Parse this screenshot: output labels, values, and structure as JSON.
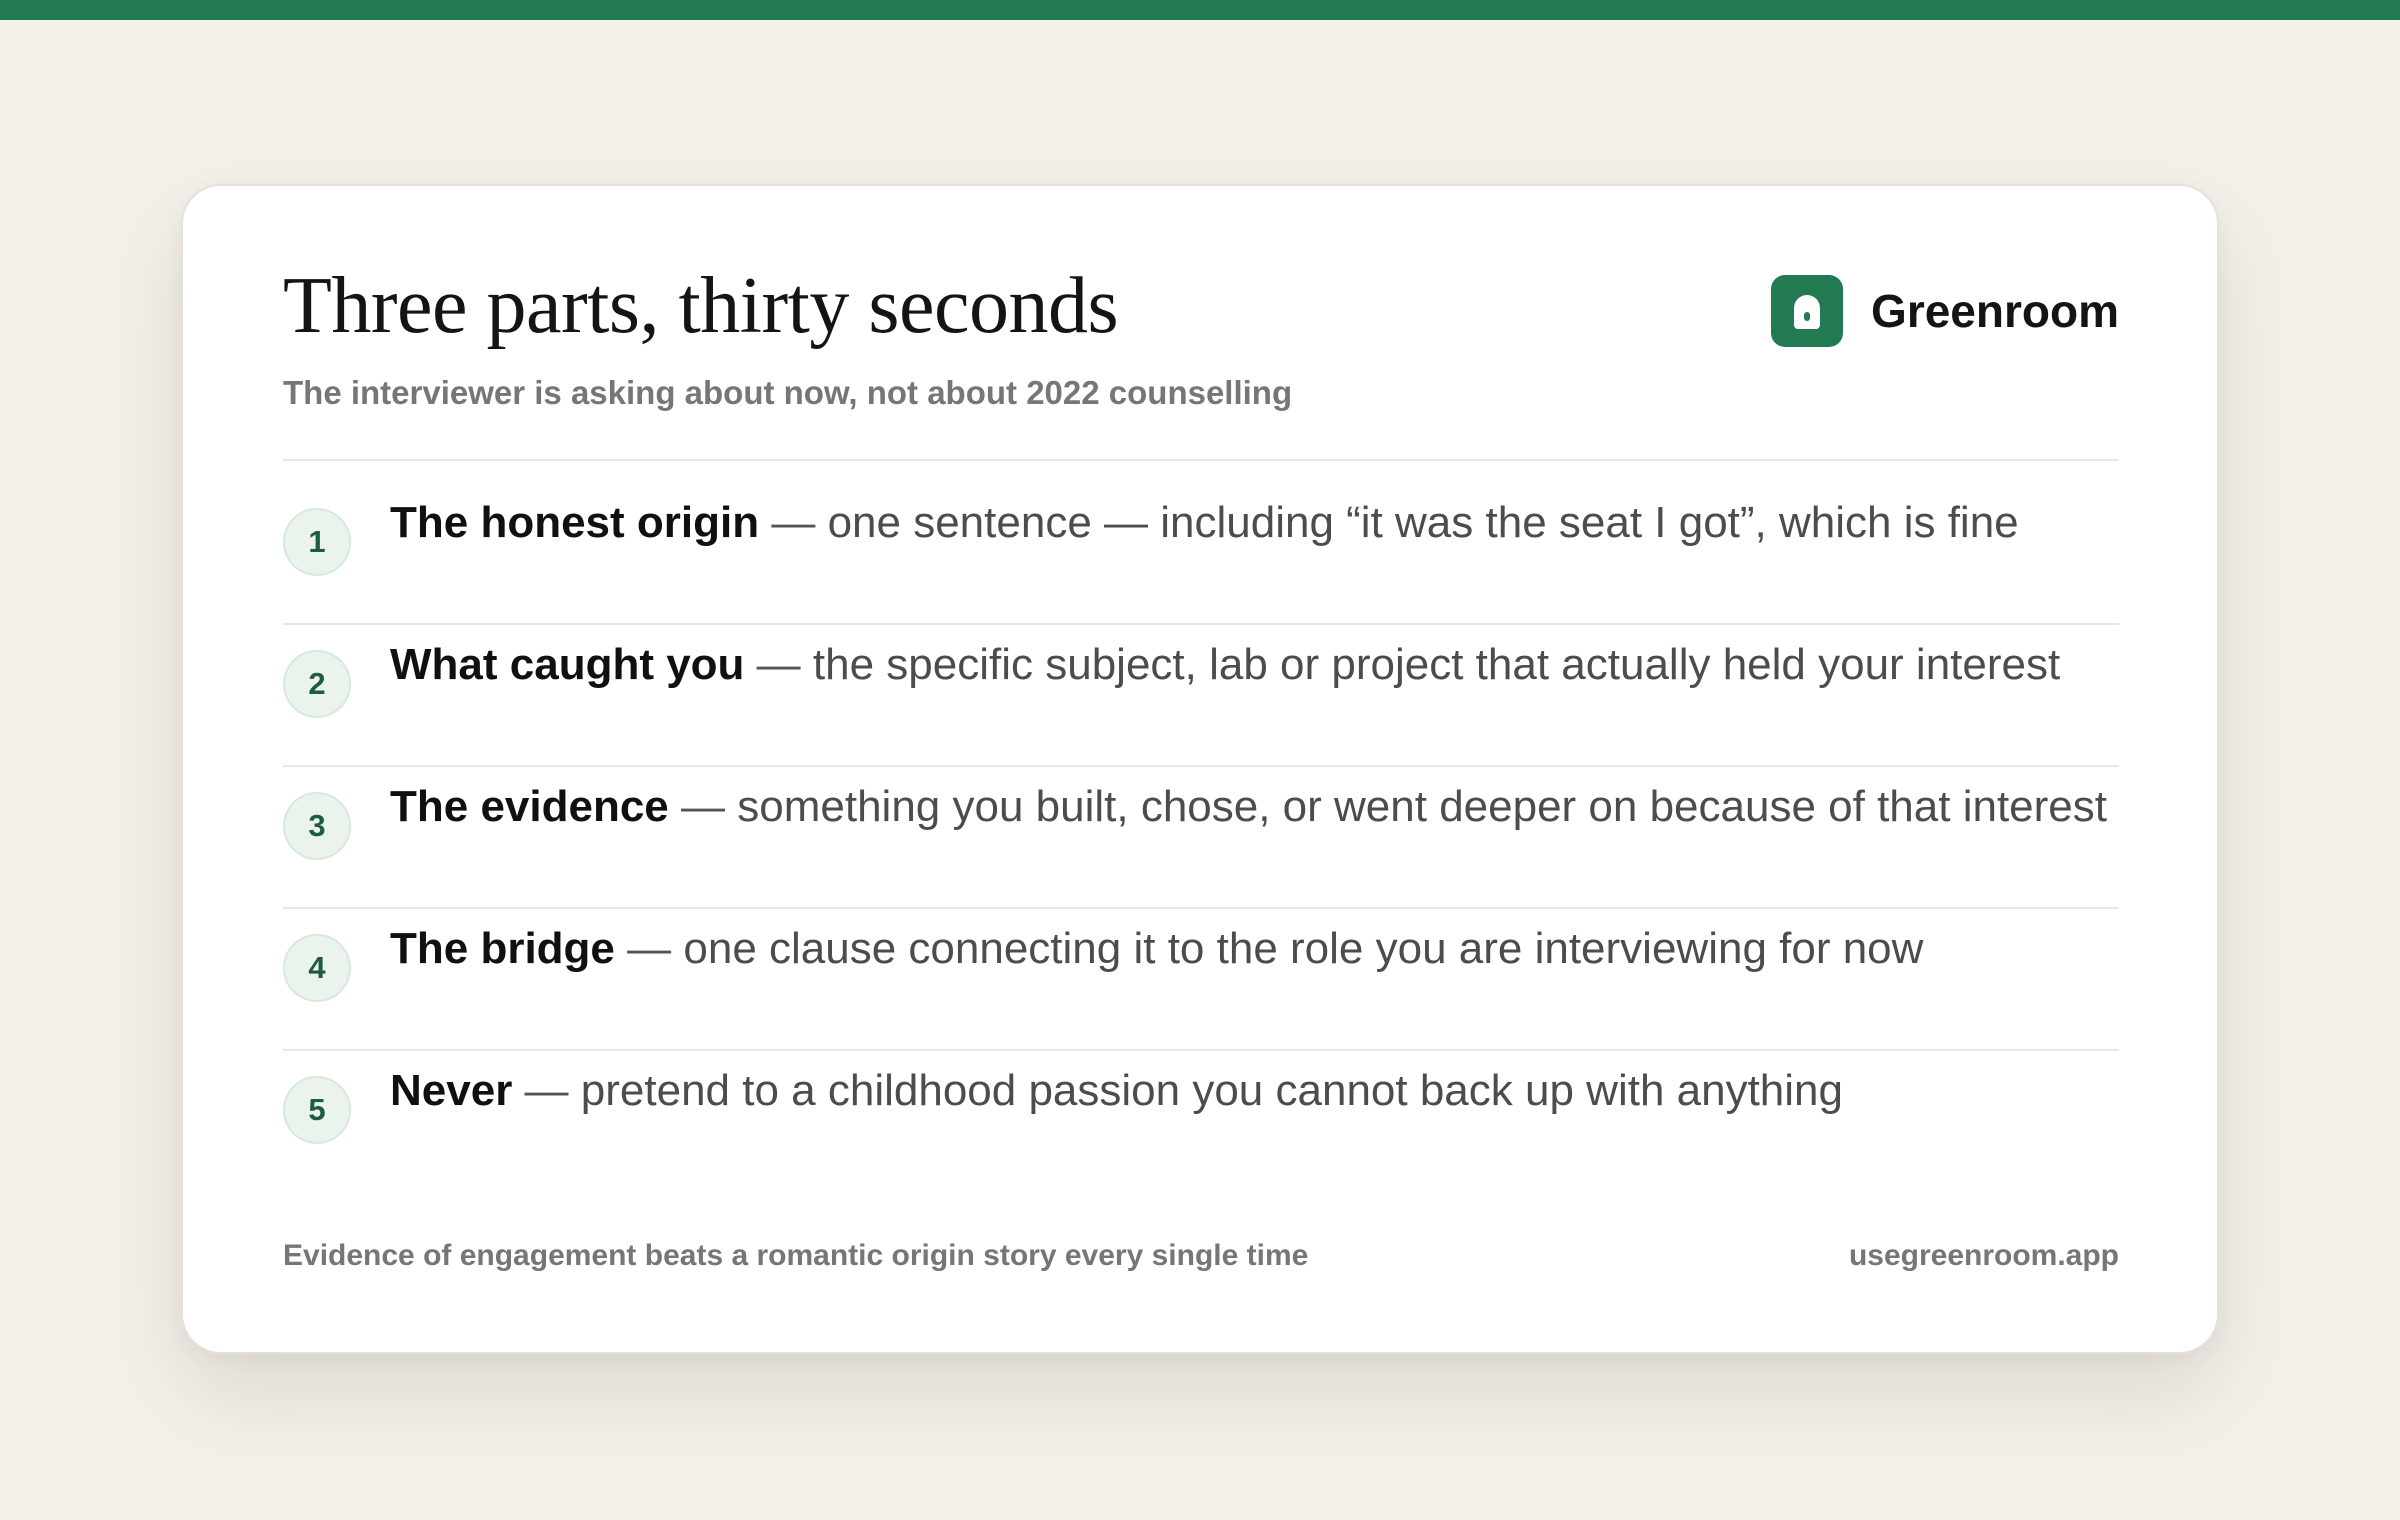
{
  "card": {
    "title": "Three parts, thirty seconds",
    "subtitle": "The interviewer is asking about now, not about 2022 counselling"
  },
  "brand": {
    "name": "Greenroom",
    "icon": "lock-icon",
    "color": "#217a52"
  },
  "steps": [
    {
      "number": "1",
      "lead": "The honest origin",
      "dash": "—",
      "body": "one sentence — including “it was the seat I got”, which is fine"
    },
    {
      "number": "2",
      "lead": "What caught you",
      "dash": "—",
      "body": "the specific subject, lab or project that actually held your interest"
    },
    {
      "number": "3",
      "lead": "The evidence",
      "dash": "—",
      "body": "something you built, chose, or went deeper on because of that interest"
    },
    {
      "number": "4",
      "lead": "The bridge",
      "dash": "—",
      "body": "one clause connecting it to the role you are interviewing for now"
    },
    {
      "number": "5",
      "lead": "Never",
      "dash": "—",
      "body": "pretend to a childhood passion you cannot back up with anything"
    }
  ],
  "footer": {
    "tagline": "Evidence of engagement beats a romantic origin story every single time",
    "url": "usegreenroom.app"
  },
  "colors": {
    "accent": "#217a52",
    "background": "#f4f1ea",
    "card": "#ffffff"
  }
}
